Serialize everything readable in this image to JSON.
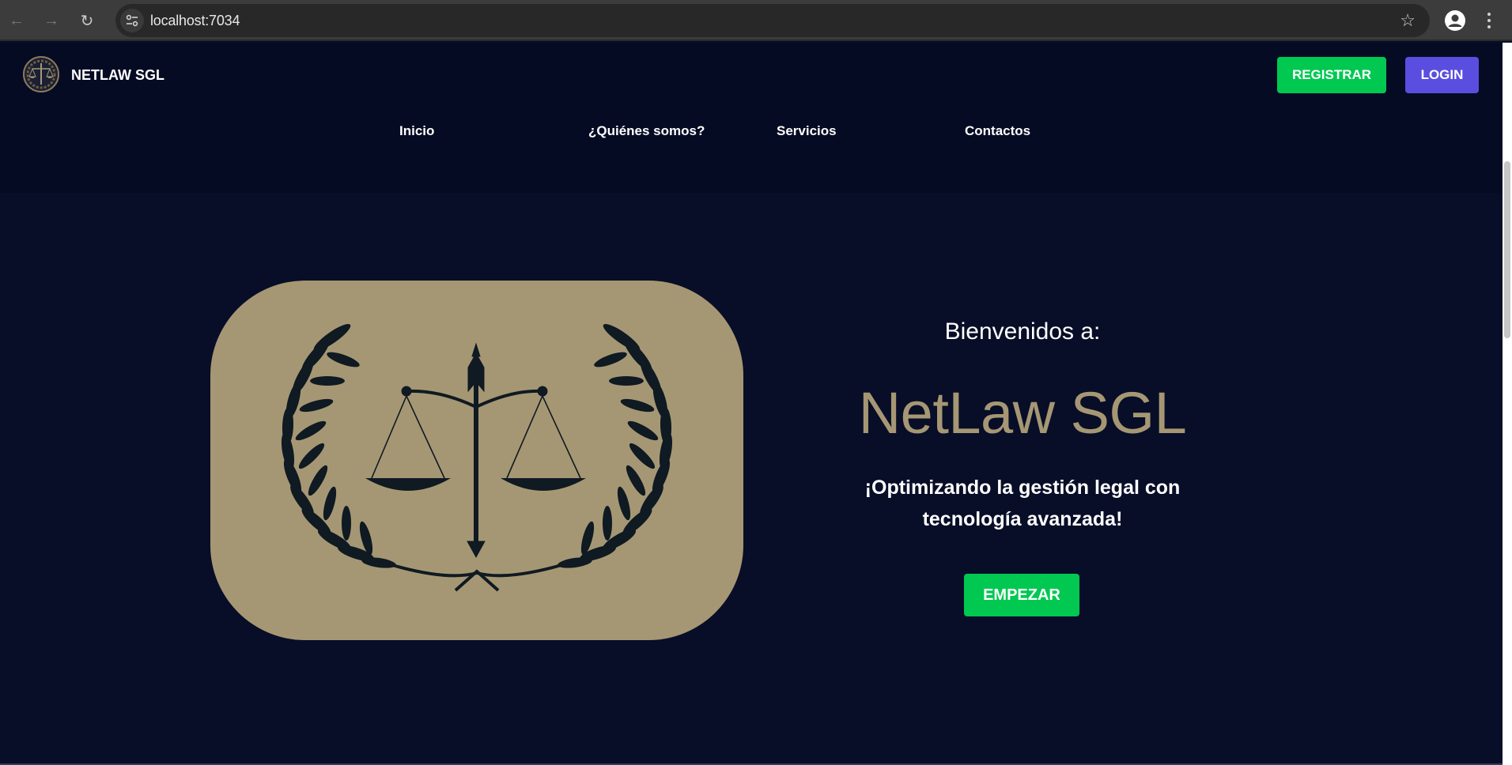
{
  "browser": {
    "url": "localhost:7034",
    "icons": {
      "back": "back-arrow-icon",
      "forward": "forward-arrow-icon",
      "reload": "reload-icon",
      "site_info": "tune-icon",
      "bookmark": "star-icon",
      "profile": "profile-icon",
      "menu": "kebab-menu-icon"
    }
  },
  "header": {
    "brand_name": "NETLAW SGL",
    "register_label": "REGISTRAR",
    "login_label": "LOGIN"
  },
  "nav": {
    "items": [
      {
        "label": "Inicio"
      },
      {
        "label": "¿Quiénes somos?"
      },
      {
        "label": "Servicios"
      },
      {
        "label": "Contactos"
      }
    ]
  },
  "hero": {
    "welcome": "Bienvenidos a:",
    "title": "NetLaw SGL",
    "tagline": "¡Optimizando la gestión legal con tecnología avanzada!",
    "start_label": "EMPEZAR"
  },
  "colors": {
    "page_bg": "#080e27",
    "gold": "#a69774",
    "green": "#00c851",
    "purple": "#5a4ee0"
  }
}
